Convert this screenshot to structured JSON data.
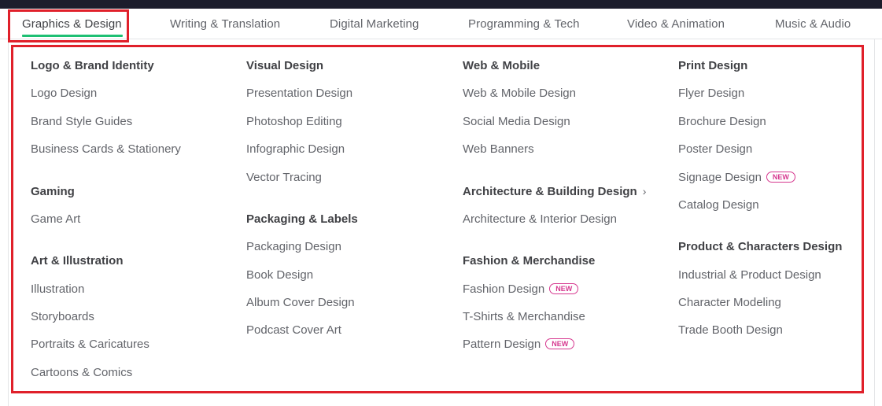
{
  "categories": [
    {
      "label": "Graphics & Design",
      "active": true
    },
    {
      "label": "Writing & Translation"
    },
    {
      "label": "Digital Marketing"
    },
    {
      "label": "Programming & Tech"
    },
    {
      "label": "Video & Animation"
    },
    {
      "label": "Music & Audio"
    }
  ],
  "badge_label": "NEW",
  "colors": {
    "accent": "#1dbf73",
    "highlight": "#e0202a",
    "new_badge": "#d6388f",
    "topbar": "#1c1d2c"
  },
  "menu": {
    "col1": {
      "group1": {
        "heading": "Logo & Brand Identity",
        "items": [
          "Logo Design",
          "Brand Style Guides",
          "Business Cards & Stationery"
        ]
      },
      "group2": {
        "heading": "Gaming",
        "items": [
          "Game Art"
        ]
      },
      "group3": {
        "heading": "Art & Illustration",
        "items": [
          "Illustration",
          "Storyboards",
          "Portraits & Caricatures",
          "Cartoons & Comics"
        ]
      }
    },
    "col2": {
      "group1": {
        "heading": "Visual Design",
        "items": [
          "Presentation Design",
          "Photoshop Editing",
          "Infographic Design",
          "Vector Tracing"
        ]
      },
      "group2": {
        "heading": "Packaging & Labels",
        "items": [
          "Packaging Design",
          "Book Design",
          "Album Cover Design",
          "Podcast Cover Art"
        ]
      }
    },
    "col3": {
      "group1": {
        "heading": "Web & Mobile",
        "items": [
          "Web & Mobile Design",
          "Social Media Design",
          "Web Banners"
        ]
      },
      "group2": {
        "heading": "Architecture & Building Design",
        "items": [
          "Architecture & Interior Design"
        ]
      },
      "group3": {
        "heading": "Fashion & Merchandise",
        "items": [
          "Fashion Design",
          "T-Shirts & Merchandise",
          "Pattern Design"
        ]
      }
    },
    "col4": {
      "group1": {
        "heading": "Print Design",
        "items": [
          "Flyer Design",
          "Brochure Design",
          "Poster Design",
          "Signage Design",
          "Catalog Design"
        ]
      },
      "group2": {
        "heading": "Product & Characters Design",
        "items": [
          "Industrial & Product Design",
          "Character Modeling",
          "Trade Booth Design"
        ]
      }
    }
  }
}
